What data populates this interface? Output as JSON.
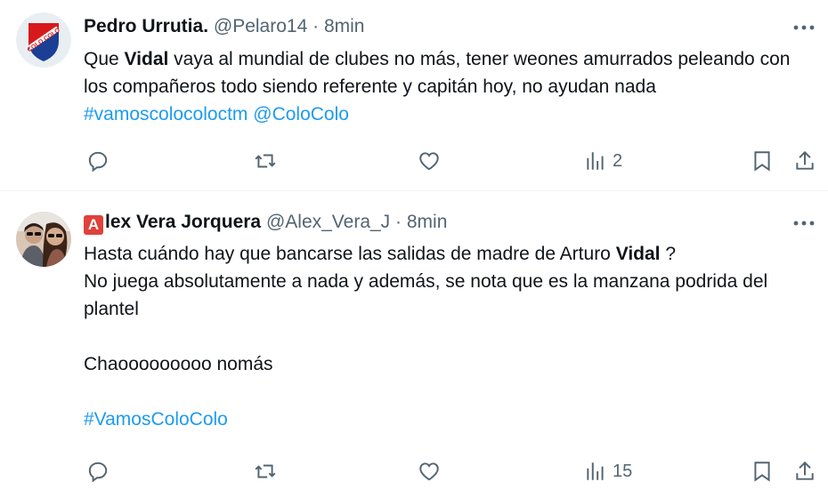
{
  "tweets": [
    {
      "author": {
        "name": "Pedro Urrutia.",
        "handle": "@Pelaro14",
        "avatar": "colo-colo-crest-avatar"
      },
      "separator": "·",
      "time": "8min",
      "text": {
        "p1": "Que ",
        "p1_bold": "Vidal",
        "p2": " vaya al mundial de clubes no más, tener weones amurrados peleando con los compañeros todo siendo referente y capitán hoy, no ayudan nada ",
        "hashtag": "#vamoscolocoloctm",
        "mention": "@ColoColo"
      },
      "stats": {
        "replies": "",
        "retweets": "",
        "likes": "",
        "views": "2"
      }
    },
    {
      "author": {
        "name_badge": "A",
        "name": "lex Vera Jorquera",
        "handle": "@Alex_Vera_J",
        "avatar": "couple-photo-avatar"
      },
      "separator": "·",
      "time": "8min",
      "text": {
        "l1a": "Hasta cuándo hay que bancarse las salidas de madre de Arturo ",
        "l1_bold": "Vidal",
        "l1b": " ?",
        "l2": "No juega absolutamente a nada y además, se nota que es la manzana podrida del plantel",
        "l3": "Chaooooooooo nomás",
        "hashtag": "#VamosColoColo"
      },
      "stats": {
        "replies": "",
        "retweets": "",
        "likes": "",
        "views": "15"
      }
    }
  ],
  "icons": [
    "more-icon",
    "reply-icon",
    "retweet-icon",
    "like-icon",
    "views-icon",
    "bookmark-icon",
    "share-icon"
  ],
  "colors": {
    "link": "#1d9bf0",
    "secondary": "#536471",
    "badge": "#e0413a",
    "club_red": "#d7191c",
    "club_blue": "#1b3f94"
  }
}
